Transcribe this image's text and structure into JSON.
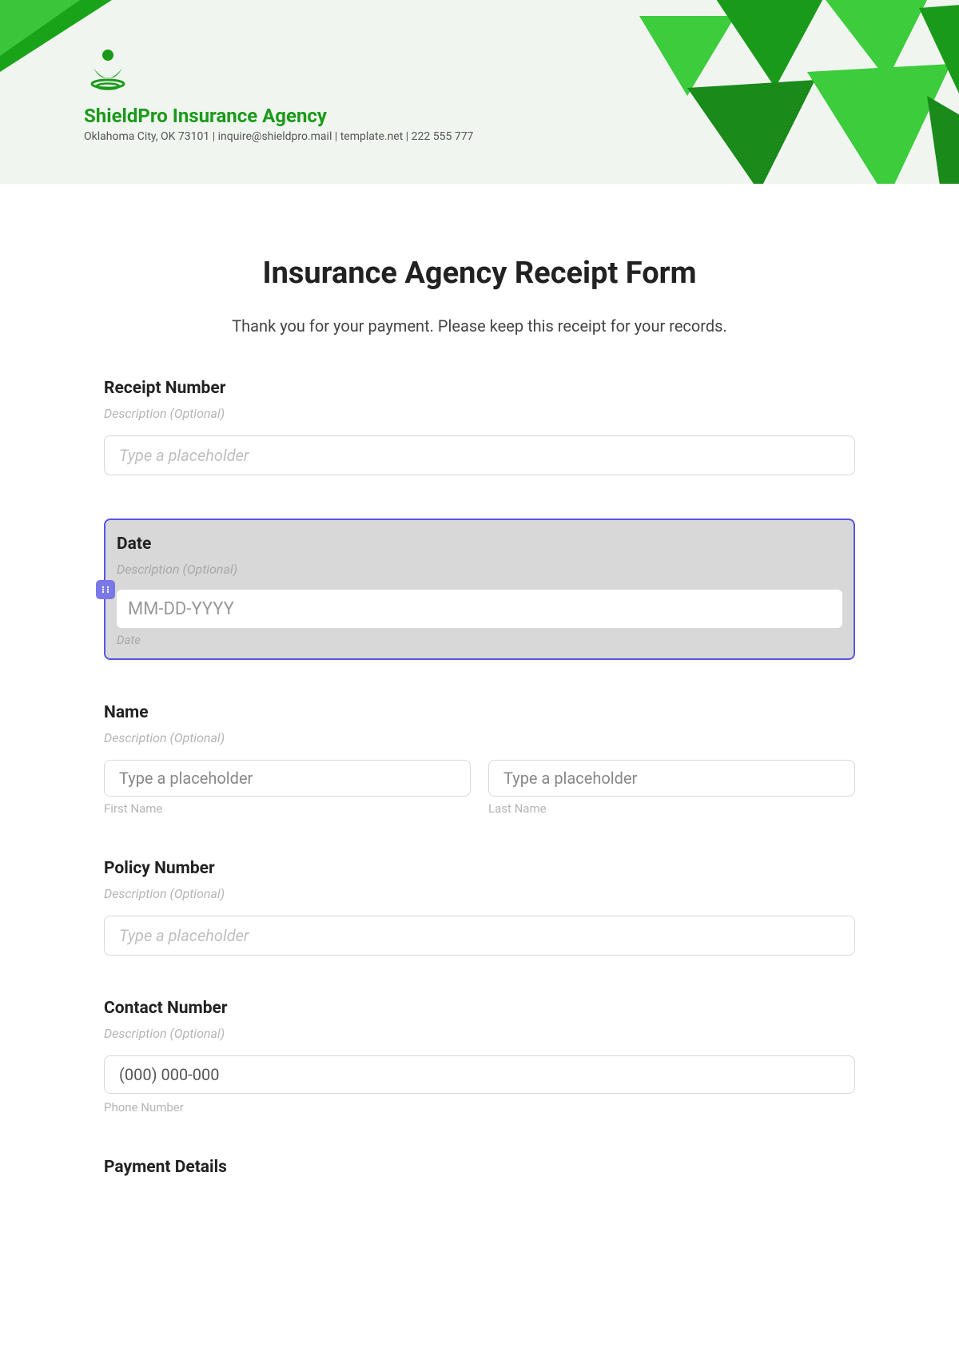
{
  "header": {
    "company_name": "ShieldPro Insurance Agency",
    "contact_line": "Oklahoma City, OK 73101 | inquire@shieldpro.mail | template.net | 222 555 777"
  },
  "form": {
    "title": "Insurance Agency Receipt Form",
    "subtitle": "Thank you for your payment. Please keep this receipt for your records."
  },
  "receipt_number": {
    "label": "Receipt Number",
    "desc": "Description (Optional)",
    "placeholder": "Type a placeholder"
  },
  "date": {
    "label": "Date",
    "desc": "Description (Optional)",
    "placeholder": "MM-DD-YYYY",
    "sublabel": "Date"
  },
  "name": {
    "label": "Name",
    "desc": "Description (Optional)",
    "first_placeholder": "Type a placeholder",
    "first_sublabel": "First Name",
    "last_placeholder": "Type a placeholder",
    "last_sublabel": "Last Name"
  },
  "policy": {
    "label": "Policy Number",
    "desc": "Description (Optional)",
    "placeholder": "Type a placeholder"
  },
  "contact": {
    "label": "Contact Number",
    "desc": "Description (Optional)",
    "placeholder": "(000) 000-000",
    "sublabel": "Phone Number"
  },
  "payment": {
    "label": "Payment Details"
  }
}
